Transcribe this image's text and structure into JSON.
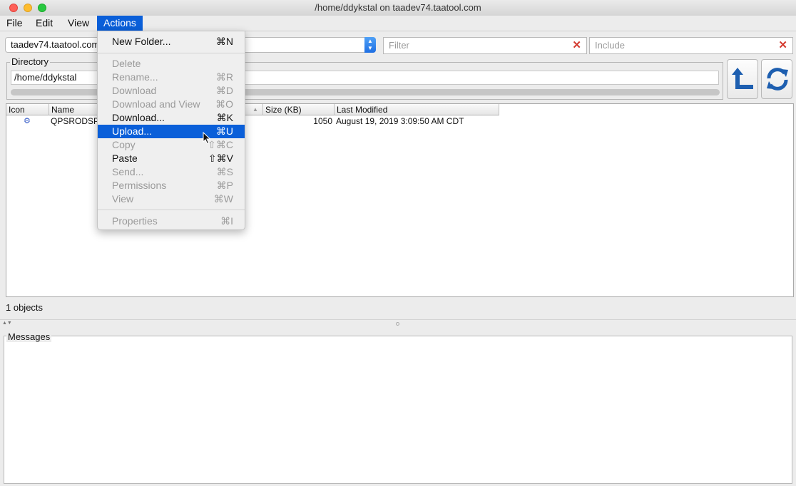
{
  "window": {
    "title": "/home/ddykstal on taadev74.taatool.com"
  },
  "menubar": {
    "items": [
      "File",
      "Edit",
      "View",
      "Actions"
    ]
  },
  "toolbar": {
    "host_value": "taadev74.taatool.com",
    "filter_placeholder": "Filter",
    "include_placeholder": "Include"
  },
  "directory": {
    "label": "Directory",
    "path": "/home/ddykstal"
  },
  "table": {
    "headers": {
      "icon": "Icon",
      "name": "Name",
      "size": "Size (KB)",
      "modified": "Last Modified"
    },
    "rows": [
      {
        "name": "QPSRODSP.",
        "size": "1050",
        "modified": "August 19, 2019 3:09:50 AM CDT"
      }
    ]
  },
  "status": {
    "count": "1 objects"
  },
  "messages": {
    "label": "Messages"
  },
  "actions_menu": [
    {
      "label": "New Folder...",
      "shortcut": "⌘N",
      "state": "enabled"
    },
    {
      "label": "Delete",
      "shortcut": "",
      "state": "disabled"
    },
    {
      "label": "Rename...",
      "shortcut": "⌘R",
      "state": "disabled"
    },
    {
      "label": "Download",
      "shortcut": "⌘D",
      "state": "disabled"
    },
    {
      "label": "Download and View",
      "shortcut": "⌘O",
      "state": "disabled"
    },
    {
      "label": "Download...",
      "shortcut": "⌘K",
      "state": "enabled"
    },
    {
      "label": "Upload...",
      "shortcut": "⌘U",
      "state": "selected"
    },
    {
      "label": "Copy",
      "shortcut": "⇧⌘C",
      "state": "disabled"
    },
    {
      "label": "Paste",
      "shortcut": "⇧⌘V",
      "state": "enabled"
    },
    {
      "label": "Send...",
      "shortcut": "⌘S",
      "state": "disabled"
    },
    {
      "label": "Permissions",
      "shortcut": "⌘P",
      "state": "disabled"
    },
    {
      "label": "View",
      "shortcut": "⌘W",
      "state": "disabled"
    },
    {
      "label": "Properties",
      "shortcut": "⌘I",
      "state": "disabled"
    }
  ],
  "colors": {
    "accent": "#0a5fd9",
    "clear_icon": "#d43a2f",
    "toolbar_icon": "#1e5fb0"
  }
}
